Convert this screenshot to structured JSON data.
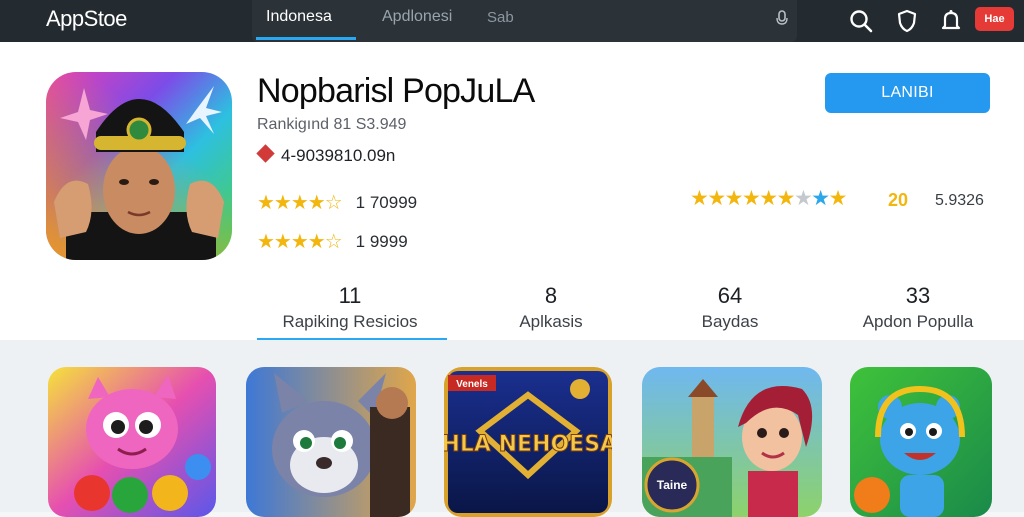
{
  "header": {
    "logo": "AppStoe",
    "tab_active": "Indonesa",
    "tab_secondary": "Apdlonesi",
    "search_placeholder": "Sab",
    "notification_badge": "Hae"
  },
  "app": {
    "title": "Nopbarisl PopJuLA",
    "subtitle": "Rankigınd 81 S3.949",
    "price": "4-9039810.09n",
    "rating_1": "1 70999",
    "rating_2": "1 9999",
    "install_label": "LANIBI",
    "score": "20",
    "score_count": "5.9326",
    "star_colors": {
      "filled": "#f3b60e",
      "empty": "#c5c9ce",
      "accent": "#2ba7ea"
    }
  },
  "stats": [
    {
      "value": "11",
      "label": "Rapiking Resicios"
    },
    {
      "value": "8",
      "label": "Aplkasis"
    },
    {
      "value": "64",
      "label": "Baydas"
    },
    {
      "value": "33",
      "label": "Apdon Populla"
    }
  ],
  "gallery": {
    "thumb_3_text": "NHLA NEHOESAS",
    "thumb_3_banner": "Venels",
    "thumb_4_text": "Taine"
  },
  "colors": {
    "accent": "#29a9f3",
    "install": "#2499ef",
    "topbar": "#232a30",
    "badge": "#e63a36"
  }
}
